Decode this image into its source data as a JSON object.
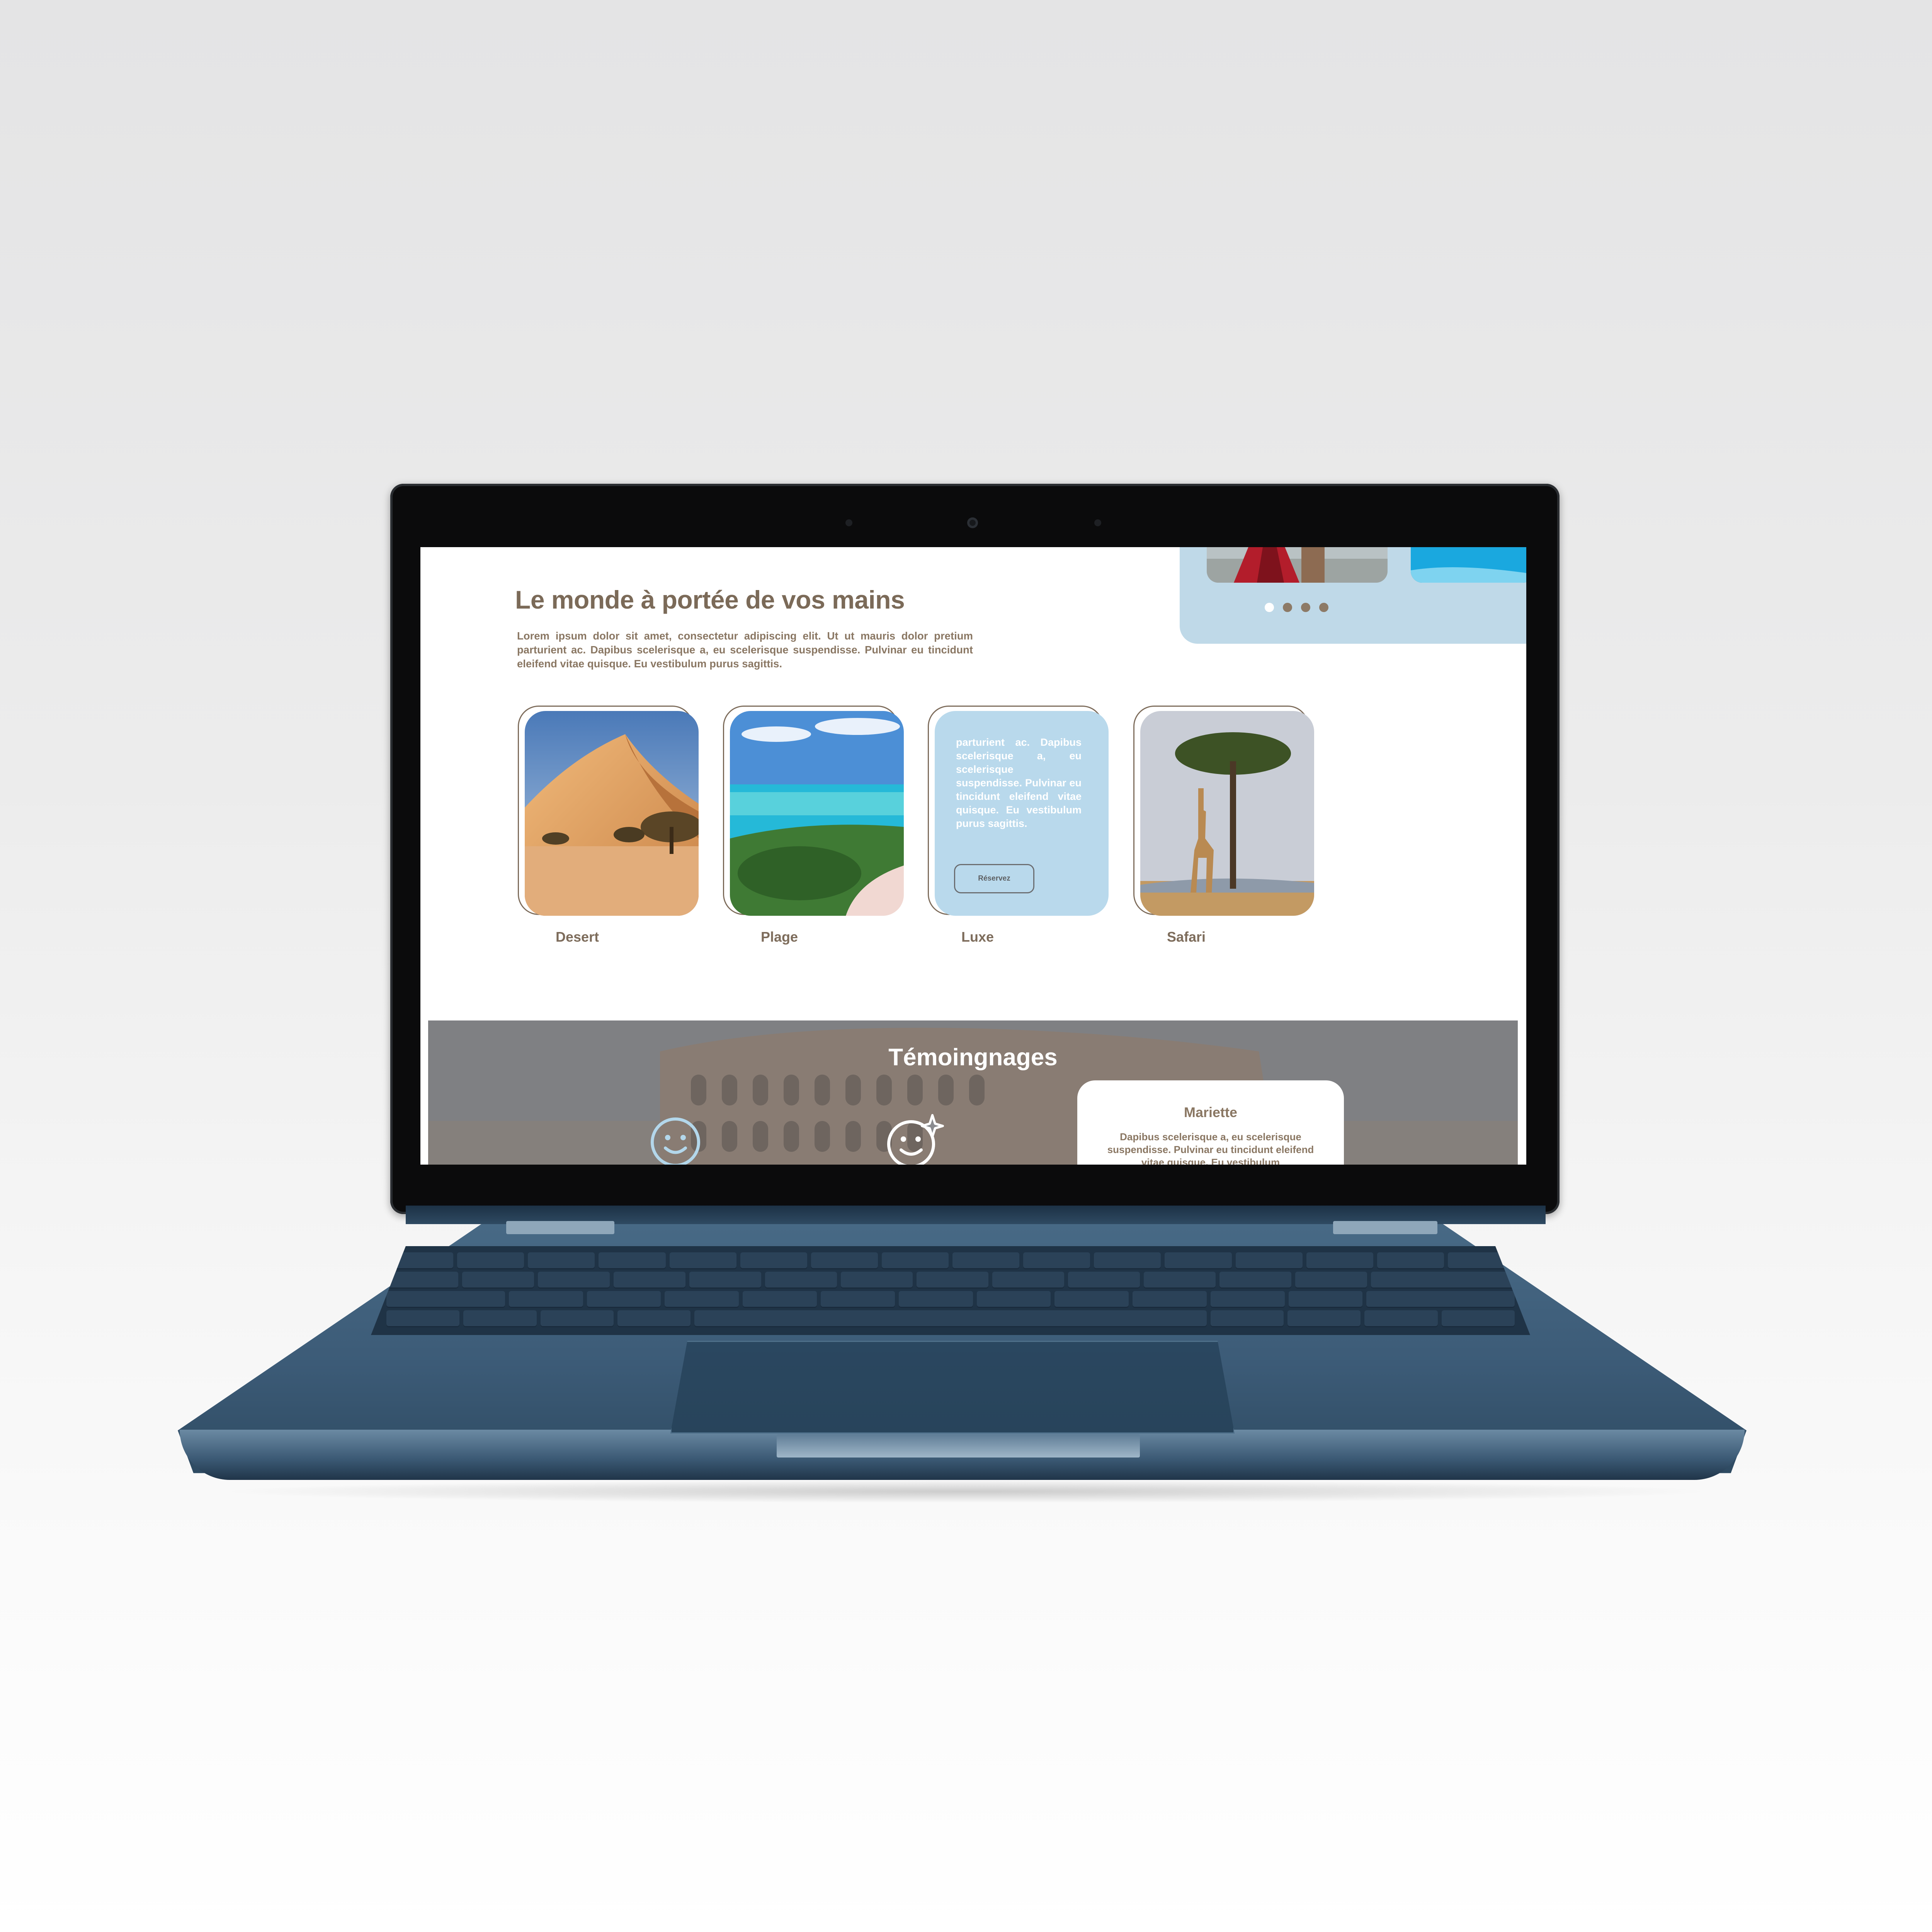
{
  "page": {
    "title": "Le monde à portée de vos mains",
    "intro": "Lorem ipsum dolor sit amet, consectetur adipiscing elit. Ut ut mauris dolor pretium parturient ac. Dapibus scelerisque a, eu scelerisque suspendisse. Pulvinar eu tincidunt eleifend vitae quisque. Eu vestibulum purus sagittis."
  },
  "hero_slider": {
    "dots": 4,
    "active_dot": 0
  },
  "categories": [
    {
      "label": "Desert",
      "image": "desert-dunes"
    },
    {
      "label": "Plage",
      "image": "tropical-beach"
    },
    {
      "label": "Luxe",
      "text": "parturient ac. Dapibus scelerisque a, eu scelerisque suspendisse. Pulvinar eu tincidunt eleifend vitae quisque. Eu vestibulum purus sagittis.",
      "button": "Réservez"
    },
    {
      "label": "Safari",
      "image": "giraffe-savanna"
    }
  ],
  "testimonials": {
    "title": "Témoingnages",
    "icons": [
      "smile-icon",
      "sparkle-smile-icon"
    ],
    "card": {
      "name": "Mariette",
      "text": "Dapibus scelerisque a, eu scelerisque suspendisse. Pulvinar eu tincidunt eleifend vitae quisque. Eu vestibulum"
    }
  },
  "colors": {
    "brown": "#7b6a58",
    "light_blue": "#bfd9e8",
    "laptop_blue": "#3c5b77"
  }
}
